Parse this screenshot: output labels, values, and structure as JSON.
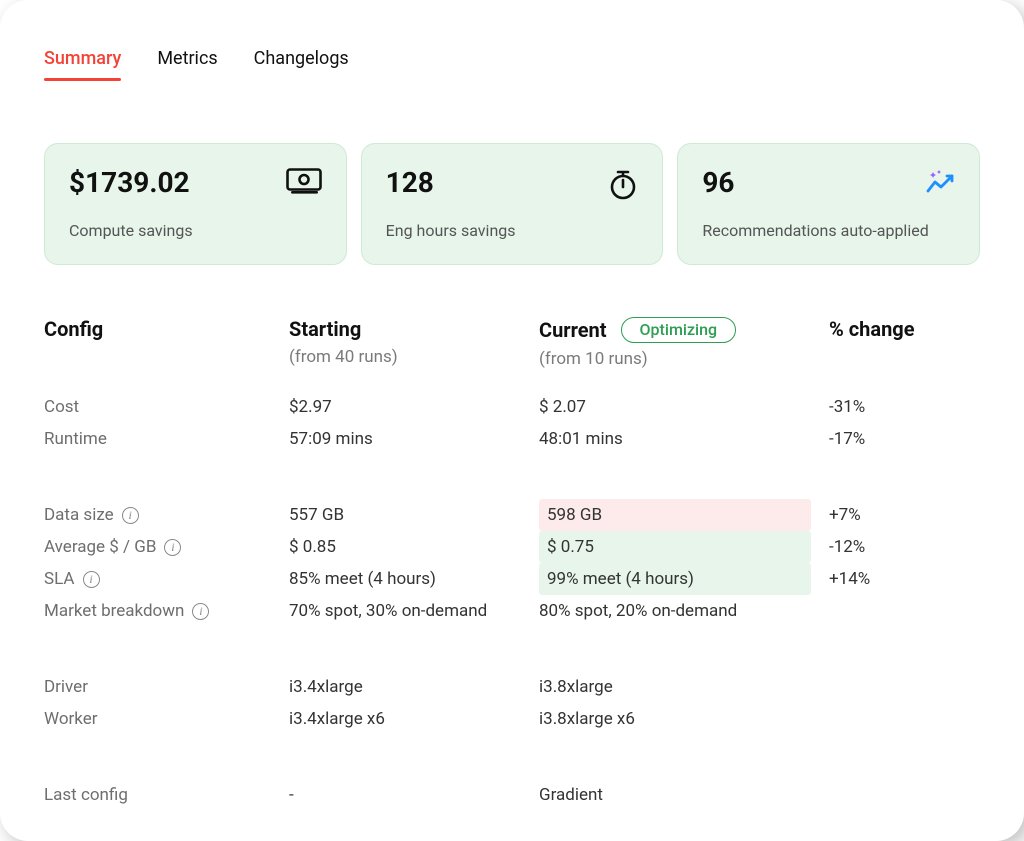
{
  "tabs": {
    "summary": "Summary",
    "metrics": "Metrics",
    "changelogs": "Changelogs"
  },
  "kpi": {
    "compute_savings": {
      "value": "$1739.02",
      "label": "Compute savings"
    },
    "eng_hours": {
      "value": "128",
      "label": "Eng hours savings"
    },
    "recs": {
      "value": "96",
      "label": "Recommendations auto-applied"
    }
  },
  "config": {
    "headers": {
      "config": "Config",
      "starting": "Starting",
      "starting_sub": "(from 40 runs)",
      "current": "Current",
      "current_sub": "(from 10 runs)",
      "badge": "Optimizing",
      "pct": "% change"
    },
    "rows": {
      "cost": {
        "label": "Cost",
        "starting": "$2.97",
        "current": "$ 2.07",
        "pct": "-31%"
      },
      "runtime": {
        "label": "Runtime",
        "starting": "57:09 mins",
        "current": "48:01 mins",
        "pct": "-17%"
      },
      "data_size": {
        "label": "Data size",
        "starting": "557 GB",
        "current": "598 GB",
        "pct": "+7%"
      },
      "avg": {
        "label": "Average $ / GB",
        "starting": "$ 0.85",
        "current": "$ 0.75",
        "pct": "-12%"
      },
      "sla": {
        "label": "SLA",
        "starting": "85% meet (4 hours)",
        "current": "99% meet (4 hours)",
        "pct": "+14%"
      },
      "market": {
        "label": "Market breakdown",
        "starting": "70% spot, 30% on-demand",
        "current": "80% spot, 20% on-demand",
        "pct": ""
      },
      "driver": {
        "label": "Driver",
        "starting": "i3.4xlarge",
        "current": "i3.8xlarge",
        "pct": ""
      },
      "worker": {
        "label": "Worker",
        "starting": "i3.4xlarge x6",
        "current": "i3.8xlarge x6",
        "pct": ""
      },
      "last": {
        "label": "Last config",
        "starting": "-",
        "current": "Gradient",
        "pct": ""
      }
    }
  }
}
